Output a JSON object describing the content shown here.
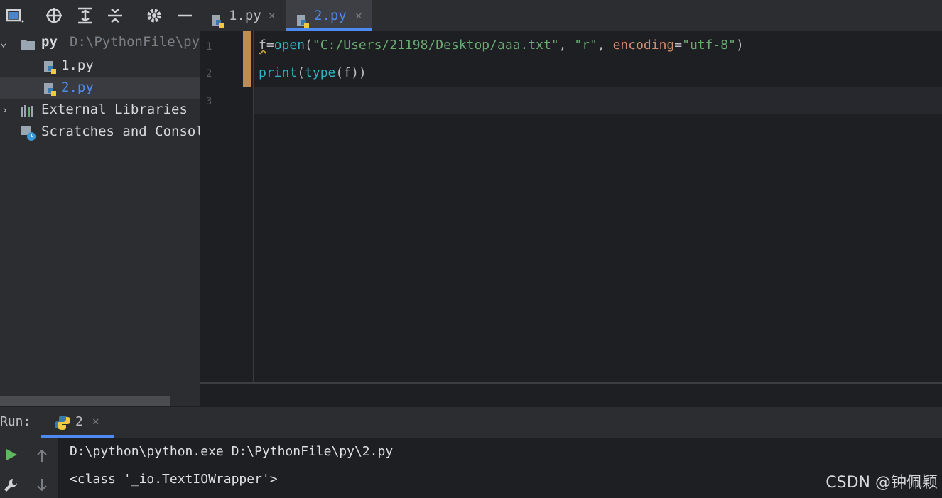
{
  "project_panel": {
    "toolbar_icons": [
      "project-view-icon",
      "locate-icon",
      "expand-all-icon",
      "collapse-all-icon",
      "settings-gear-icon",
      "minimize-icon"
    ],
    "tree": [
      {
        "label": "py",
        "path": "D:\\PythonFile\\py",
        "icon": "folder-icon",
        "expanded": true
      },
      {
        "label": "1.py",
        "icon": "python-file-icon"
      },
      {
        "label": "2.py",
        "icon": "python-file-icon",
        "selected": true
      },
      {
        "label": "External Libraries",
        "icon": "libraries-icon",
        "expanded": false
      },
      {
        "label": "Scratches and Consoles",
        "icon": "scratches-icon"
      }
    ]
  },
  "tabs": [
    {
      "label": "1.py",
      "active": false
    },
    {
      "label": "2.py",
      "active": true
    }
  ],
  "editor": {
    "line_numbers": [
      "1",
      "2",
      "3"
    ],
    "lines": [
      {
        "segments": [
          {
            "text": "f",
            "kind": "plain",
            "squiggle": true
          },
          {
            "text": "=",
            "kind": "plain"
          },
          {
            "text": "open",
            "kind": "builtin"
          },
          {
            "text": "(",
            "kind": "plain"
          },
          {
            "text": "\"C:/Users/21198/Desktop/aaa.txt\"",
            "kind": "str"
          },
          {
            "text": ", ",
            "kind": "plain"
          },
          {
            "text": "\"r\"",
            "kind": "str"
          },
          {
            "text": ", ",
            "kind": "plain"
          },
          {
            "text": "encoding",
            "kind": "kw"
          },
          {
            "text": "=",
            "kind": "plain"
          },
          {
            "text": "\"utf-8\"",
            "kind": "str"
          },
          {
            "text": ")",
            "kind": "plain"
          }
        ]
      },
      {
        "segments": [
          {
            "text": "print",
            "kind": "builtin"
          },
          {
            "text": "(",
            "kind": "plain"
          },
          {
            "text": "type",
            "kind": "builtin"
          },
          {
            "text": "(f))",
            "kind": "plain"
          }
        ]
      },
      {
        "segments": []
      }
    ]
  },
  "run": {
    "label": "Run:",
    "tab_label": "2",
    "console": [
      "D:\\python\\python.exe D:\\PythonFile\\py\\2.py",
      "<class '_io.TextIOWrapper'>"
    ]
  },
  "watermark": "CSDN @钟佩颖",
  "colors": {
    "accent": "#4d8bf0",
    "change_marker": "#c48a53",
    "run_green": "#5fb85f"
  }
}
